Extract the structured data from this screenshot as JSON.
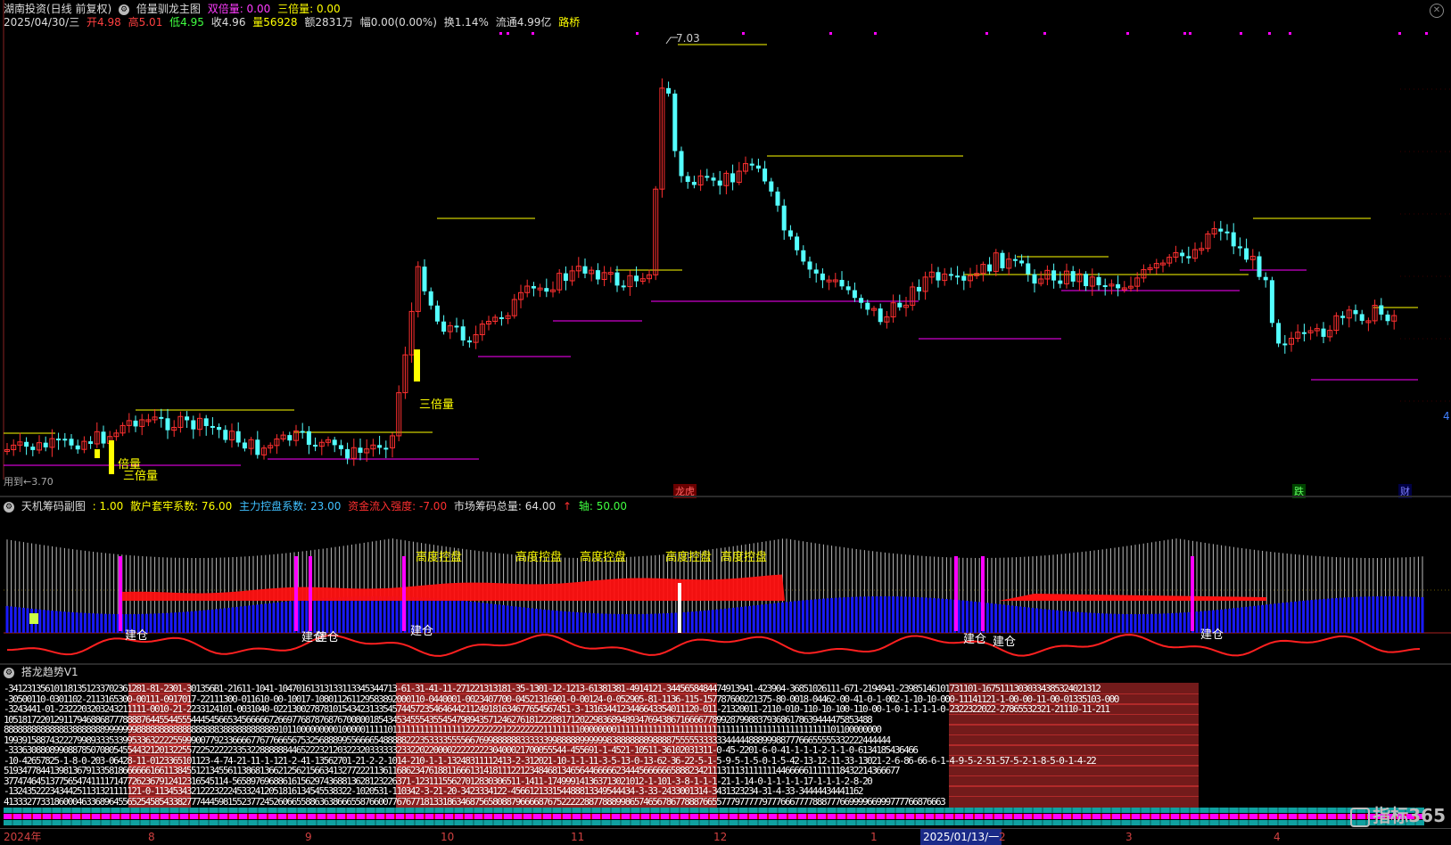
{
  "main_header": {
    "stock": "湖南投资(日线 前复权)",
    "indicator": "倍量驯龙主图",
    "double_label": "双倍量: 0.00",
    "triple_label": "三倍量: 0.00",
    "close_icon": "close-icon"
  },
  "quote": {
    "date": "2025/04/30/三",
    "open": "开4.98",
    "high": "高5.01",
    "low": "低4.95",
    "close": "收4.96",
    "volume": "量56928",
    "amount": "额2831万",
    "change": "幅0.00(0.00%)",
    "turnover": "换1.14%",
    "float_cap": "流通4.99亿",
    "concept": "路桥"
  },
  "main_annotations": {
    "peak_price": "7.03",
    "triple_1": "三倍量",
    "triple_2": "三倍量",
    "double": "倍量",
    "used_to": "用到←3.70",
    "marker_dragon": "龙虎",
    "marker_fall": "跌",
    "marker_finance": "财",
    "right_edge": "4"
  },
  "sub_header": {
    "title": "天机筹码副图",
    "v1": ": 1.00",
    "retail": "散户套牢系数: 76.00",
    "main_control": "主力控盘系数: 23.00",
    "inflow": "资金流入强度: -7.00",
    "market_total": "市场筹码总量: 64.00",
    "axis": "轴: 50.00"
  },
  "sub_annotations": {
    "control": "高度控盘",
    "build": "建仓"
  },
  "trend_header": {
    "title": "搭龙趋势V1"
  },
  "trend_rows": [
    "-341231356101181351233702361281-81-2301-301356B1-21611-1041-10470161313133113345344713-61-31-41-11-271221313181-35-1301-12-1213-61381381-4914121-3445658484474913941-423904-36851026111-671-2194941-23985146101731101-16751113030334385324021312",
    "-30500110-0301102-2113165300-00111-0917017-22111300-011610-00-10017-108011261129583892000110-0440001-0023407700-04521316901-0-00124-0-052905-81-1136-115-157787600221375-80-0018-04462-00-41-0-1-002-1-10-10-000-11141121-1-00-00-11-00-01335103-000",
    "-3243441-01-2322203203243211111-0010-21-2233124101-0031040-02213002787810154342313354574457235464644211249181634677654567451-3-1316344123446643354011120-011-21320011-2110-010-110-10-100-110-00-1-0-1-1-1-1-0-2322322022-27865532321-21110-11-211",
    "1051817220129117946886877788887644554455544454566534566666726697768787687670080018543453455543554547989435712462761812228817120229836894893476943867166667789928799883793686178639444475853488",
    "888888888888883888888899999998888888888888888883888888888889101100000000010000011111011111111111111112222222212222222211111111000000001111111111111111111111111111111111111111111111101100000000",
    "19939158874322279989333533995336322225599900779233666677677666567532568889955666654888882223533335555667699888888333333998888899999983888888898888755555333333444448889998877766655555332222444444",
    "-33363088089908878507080545544321201322557225222223353228888884465222321203223203333332332202200002222222230400021700055544-455691-1-4521-10511-36102031311-0-45-2201-6-0-41-1-1-1-2-1-1-0-6134185436466",
    "-10-42657825-1-8-0-203-06428-11-0123365101123-4-74-21-11-1-121-2-41-13562701-21-2-2-1014-210-1-1-13248311112413-2-312021-10-1-1-11-3-5-13-0-13-62-36-22-5-1-5-9-5-1-5-0-1-5-42-13-12-11-33-13021-2-6-86-66-6-1-4-9-5-2-51-57-5-2-1-8-5-0-1-4-22",
    "5193477844139813679133581866666616611384551213455611386813662125621566341327722211361168623476188116661314181112212348468134656446666623444566666658882342111311131111111446666611111118432214366677",
    "3774746451377565474111171477262367912412316545114-565897696886161562974368813628123226371-12311155627012830306511-1411-174999141363713021012-1-101-3-8-1-1-1-21-1-14-0-1-1-1-1-17-1-1-1-2-8-20",
    "-13243522234344251131321111121-0-1134534321222322245332412051816134545538322-1020531-110342-3-21-20-3423334122-456612133154488813349544434-3-33-2433001314-3431323234-31-4-33-34444434441162",
    "41333277331860004633689645565254585433827774445981552377245260665588636386665587660077676771813318634687565808879666687675222228877888998657465678677888766557779777779777666777788877766999966999777766876663"
  ],
  "time_axis": {
    "labels": [
      "2024年",
      "8",
      "9",
      "10",
      "11",
      "12",
      "1",
      "2025/01/13/一",
      "2",
      "3",
      "4"
    ]
  },
  "logo": "指标365",
  "colors": {
    "up": "#ff3030",
    "down": "#54ffff",
    "yellow": "#ffff00",
    "magenta": "#ff00ff",
    "red": "#ff0000",
    "blue": "#1a1aff"
  }
}
